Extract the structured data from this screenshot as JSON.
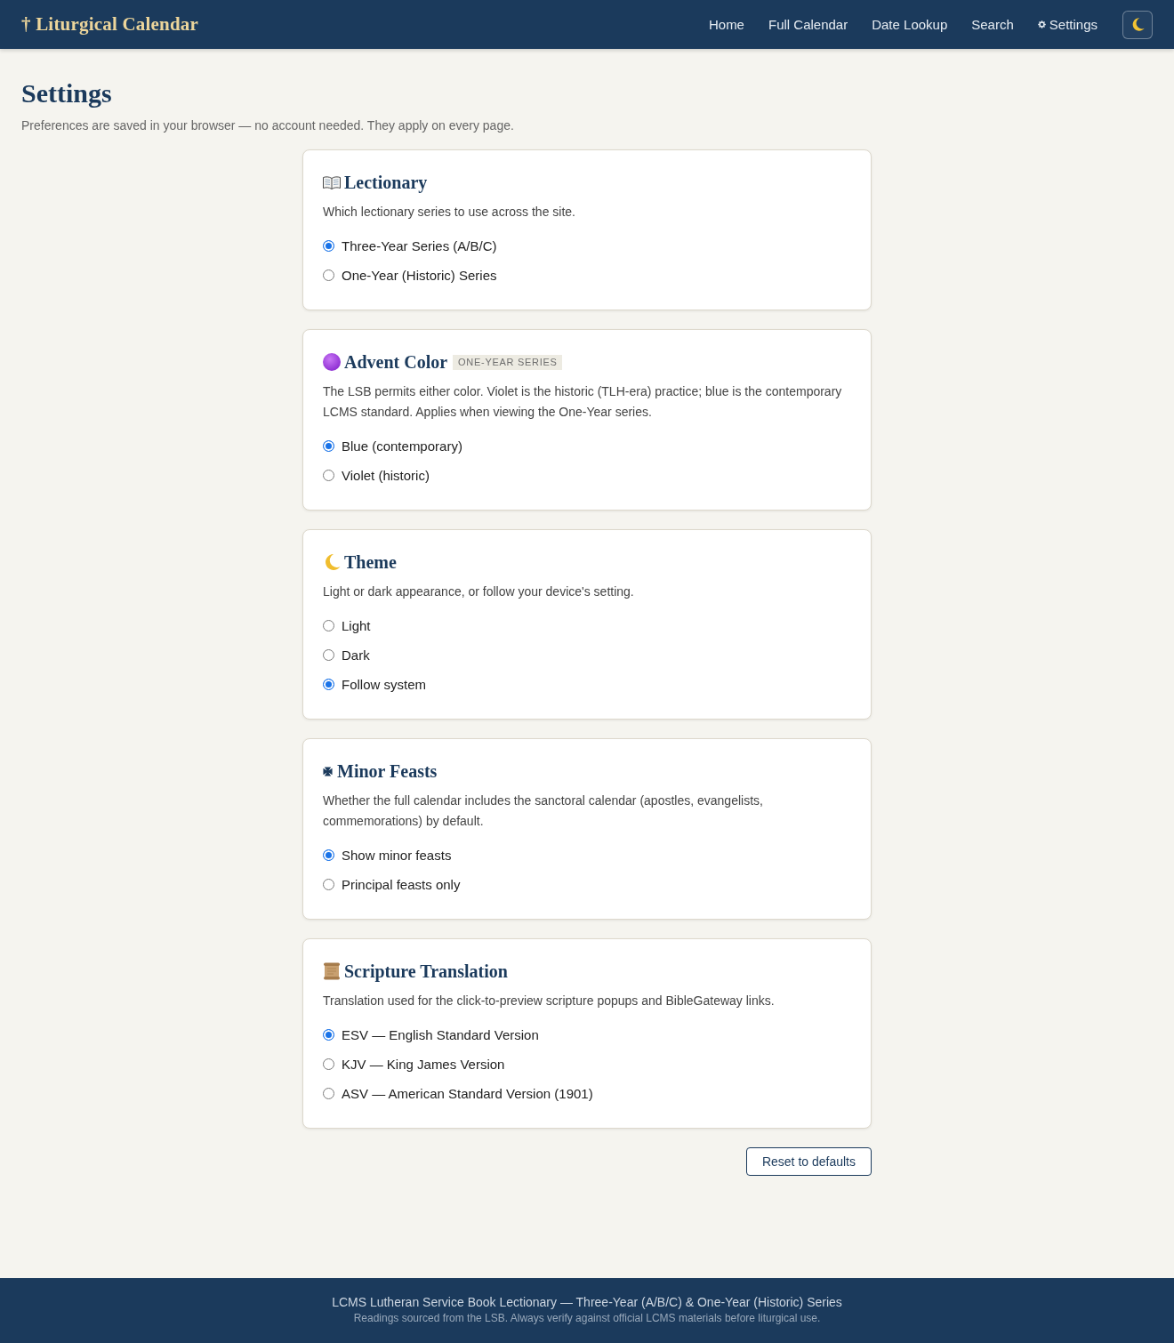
{
  "header": {
    "brand": "† Liturgical Calendar",
    "nav": [
      {
        "label": "Home",
        "kind": "plain"
      },
      {
        "label": "Full Calendar",
        "kind": "plain"
      },
      {
        "label": "Date Lookup",
        "kind": "plain"
      },
      {
        "label": "Search",
        "kind": "plain"
      },
      {
        "label": "Settings",
        "kind": "gear"
      }
    ]
  },
  "page": {
    "title": "Settings",
    "subtitle": "Preferences are saved in your browser — no account needed. They apply on every page."
  },
  "sections": [
    {
      "title": "Lectionary",
      "description": "Which lectionary series to use across the site.",
      "options": [
        {
          "label": "Three-Year Series (A/B/C)",
          "selected": true
        },
        {
          "label": "One-Year (Historic) Series",
          "selected": false
        }
      ]
    },
    {
      "title": "Advent Color",
      "badge": "ONE-YEAR SERIES",
      "description": "The LSB permits either color. Violet is the historic (TLH-era) practice; blue is the contemporary LCMS standard. Applies when viewing the One-Year series.",
      "options": [
        {
          "label": "Blue (contemporary)",
          "selected": true
        },
        {
          "label": "Violet (historic)",
          "selected": false
        }
      ]
    },
    {
      "title": "Theme",
      "description": "Light or dark appearance, or follow your device's setting.",
      "options": [
        {
          "label": "Light",
          "selected": false
        },
        {
          "label": "Dark",
          "selected": false
        },
        {
          "label": "Follow system",
          "selected": true
        }
      ]
    },
    {
      "title": "Minor Feasts",
      "description": "Whether the full calendar includes the sanctoral calendar (apostles, evangelists, commemorations) by default.",
      "options": [
        {
          "label": "Show minor feasts",
          "selected": true
        },
        {
          "label": "Principal feasts only",
          "selected": false
        }
      ]
    },
    {
      "title": "Scripture Translation",
      "description": "Translation used for the click-to-preview scripture popups and BibleGateway links.",
      "options": [
        {
          "label": "ESV — English Standard Version",
          "selected": true
        },
        {
          "label": "KJV — King James Version",
          "selected": false
        },
        {
          "label": "ASV — American Standard Version (1901)",
          "selected": false
        }
      ]
    }
  ],
  "reset_button": "Reset to defaults",
  "footer": {
    "line_1": "LCMS Lutheran Service Book Lectionary — Three-Year (A/B/C) & One-Year (Historic) Series",
    "line_2": "Readings sourced from the LSB. Always verify against official LCMS materials before liturgical use."
  }
}
